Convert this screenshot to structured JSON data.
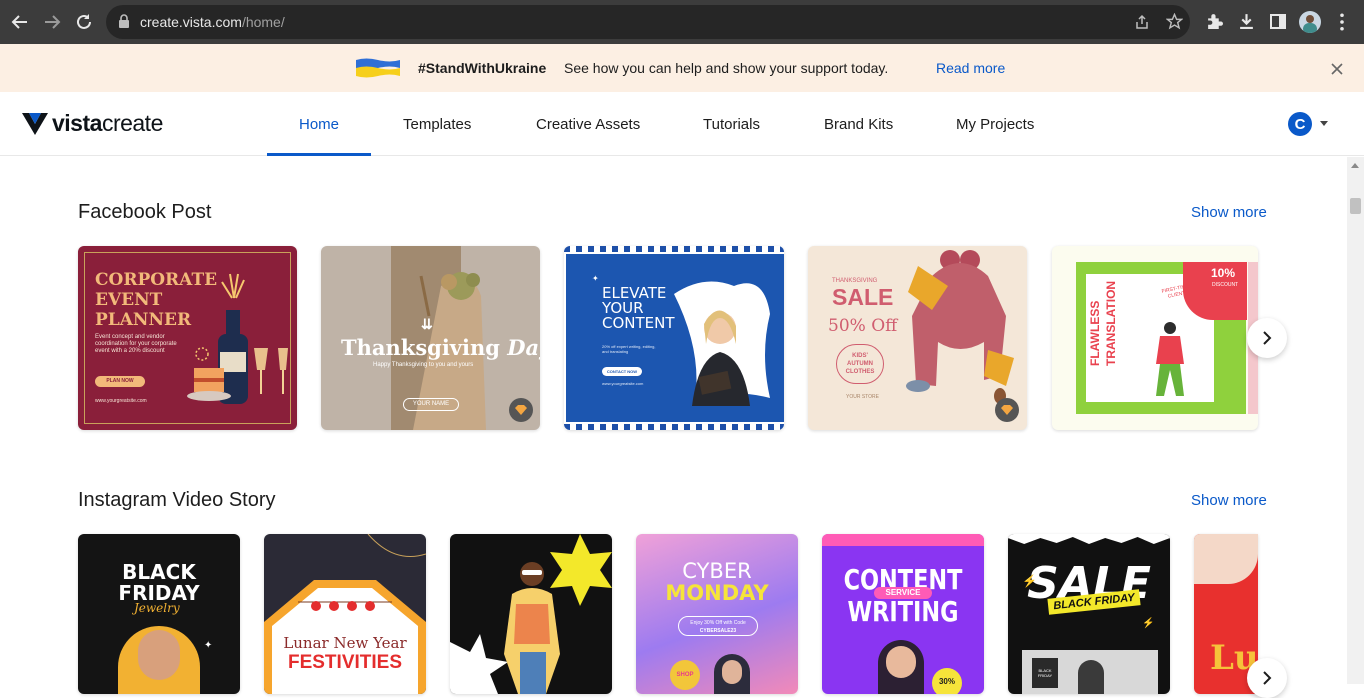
{
  "browser": {
    "url_host": "create.vista.com",
    "url_path": "/home/"
  },
  "banner": {
    "hashtag": "#StandWithUkraine",
    "message": "See how you can help and show your support today.",
    "link": "Read more"
  },
  "header": {
    "logo_bold": "vista",
    "logo_light": "create",
    "nav": [
      "Home",
      "Templates",
      "Creative Assets",
      "Tutorials",
      "Brand Kits",
      "My Projects"
    ],
    "active_nav": "Home",
    "avatar_letter": "C"
  },
  "sections": [
    {
      "title": "Facebook Post",
      "show_more": "Show more",
      "cards": [
        {
          "lines": [
            "CORPORATE",
            "EVENT",
            "PLANNER"
          ],
          "sub": "Event concept and vendor coordination for your corporate event with a 20% discount",
          "button": "PLAN NOW",
          "footer": "www.yourgreatsite.com"
        },
        {
          "title_a": "Thanksgiving",
          "title_b": "Day",
          "sub": "Happy Thanksgiving to you and yours",
          "button": "YOUR NAME"
        },
        {
          "lines": [
            "ELEVATE",
            "YOUR",
            "CONTENT"
          ],
          "sub": "20% off expert writing, editing, and translating",
          "button": "CONTACT NOW",
          "footer": "www.yourgreatsite.com"
        },
        {
          "tag": "THANKSGIVING",
          "title": "SALE",
          "discount": "50% Off",
          "badge_lines": [
            "KIDS'",
            "AUTUMN",
            "CLOTHES"
          ],
          "footer": "YOUR STORE"
        },
        {
          "vertical_a": "FLAWLESS",
          "vertical_b": "TRANSLATION",
          "ribbon": "FIRST-TIME CLIENT",
          "percent": "10%",
          "discount": "DISCOUNT"
        }
      ]
    },
    {
      "title": "Instagram Video Story",
      "show_more": "Show more",
      "cards": [
        {
          "lines": [
            "BLACK",
            "FRIDAY"
          ],
          "script": "Jewelry"
        },
        {
          "title": "Lunar New Year",
          "title2": "FESTIVITIES"
        },
        {
          "label": ""
        },
        {
          "lines": [
            "CYBER",
            "MONDAY"
          ],
          "sub": "Enjoy 30% Off with Code",
          "code": "CYBERSALE23",
          "sticker": "SHOP NOW"
        },
        {
          "lines": [
            "CONTENT",
            "WRITING"
          ],
          "badge": "SERVICE",
          "percent": "30%"
        },
        {
          "sale": "SALE",
          "banner": "BLACK FRIDAY",
          "tag": "BLACK FRIDAY"
        },
        {
          "partial": "Lu"
        }
      ]
    }
  ],
  "colors": {
    "accent": "#0a59c9",
    "banner_bg": "#fcefe3",
    "chrome_bg": "#3c3c3c"
  }
}
